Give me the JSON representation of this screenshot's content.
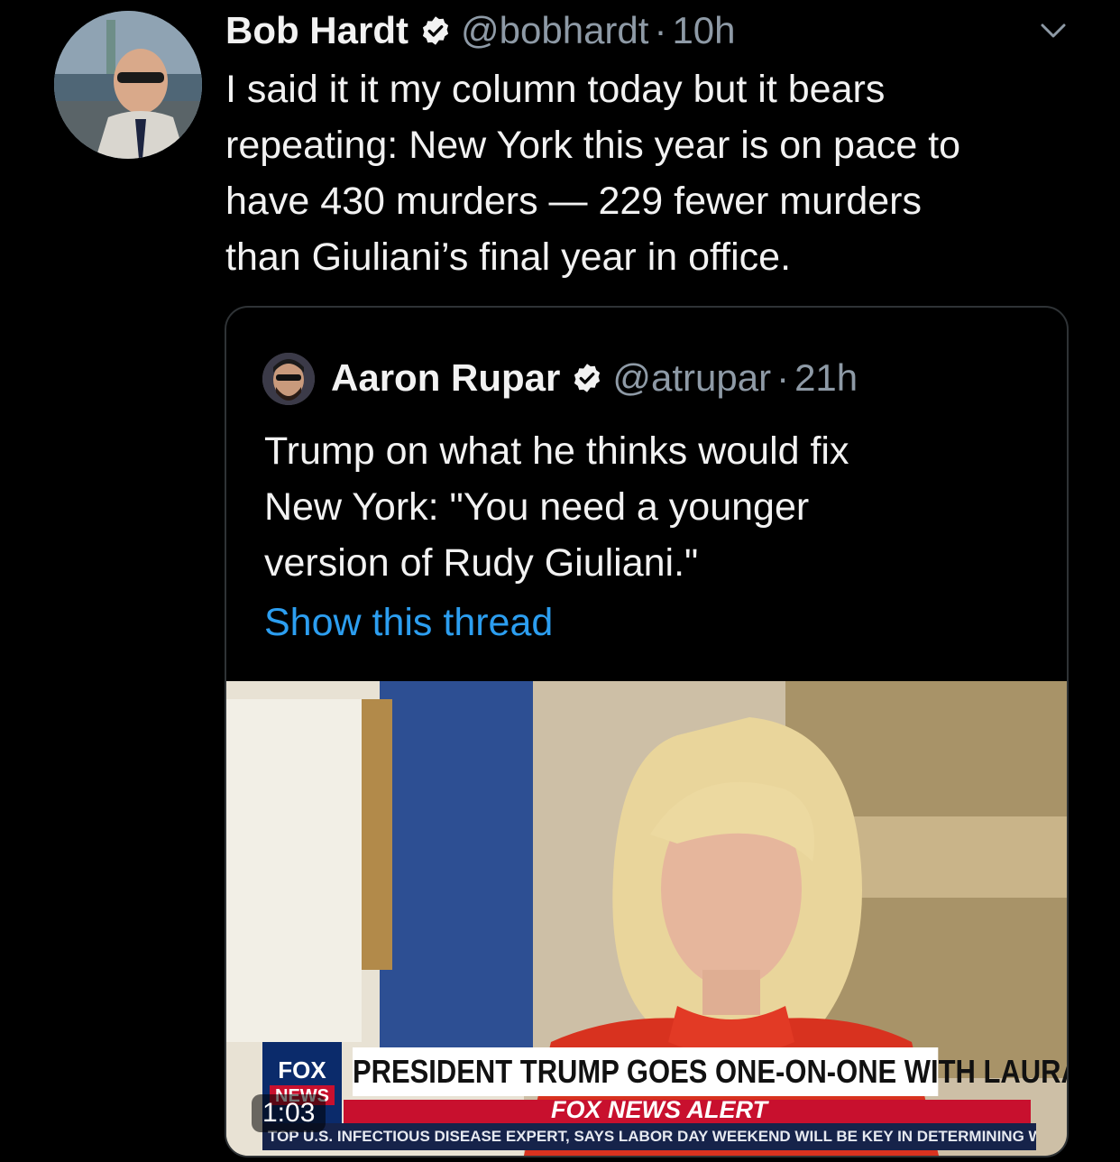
{
  "tweet": {
    "author_name": "Bob Hardt",
    "handle": "@bobhardt",
    "separator": "·",
    "time": "10h",
    "text_lines": [
      "I said it it my column today but it bears",
      "repeating: New York this year is on pace to",
      "have 430 murders — 229 fewer murders",
      "than Giuliani’s final year in office."
    ]
  },
  "quoted_tweet": {
    "author_name": "Aaron Rupar",
    "handle": "@atrupar",
    "separator": "·",
    "time": "21h",
    "text_lines": [
      "Trump on what he thinks would fix",
      "New York: \"You need a younger",
      "version of Rudy Giuliani.\""
    ],
    "show_thread_label": "Show this thread",
    "video": {
      "duration": "1:03",
      "chyron_headline": "PRESIDENT TRUMP GOES ONE-ON-ONE WITH LAURA",
      "alert_label": "FOX NEWS ALERT",
      "logo_text_top": "FOX",
      "logo_text_bottom": "NEWS",
      "ticker_text": "TOP U.S. INFECTIOUS DISEASE EXPERT, SAYS LABOR DAY WEEKEND WILL BE KEY IN DETERMINING WHETHE"
    }
  },
  "colors": {
    "background": "#000000",
    "link_blue": "#2c9ef0",
    "muted_gray": "#8e9aa6",
    "fox_red": "#c8102e"
  },
  "icons": [
    "verified-badge-icon",
    "chevron-down-icon"
  ]
}
